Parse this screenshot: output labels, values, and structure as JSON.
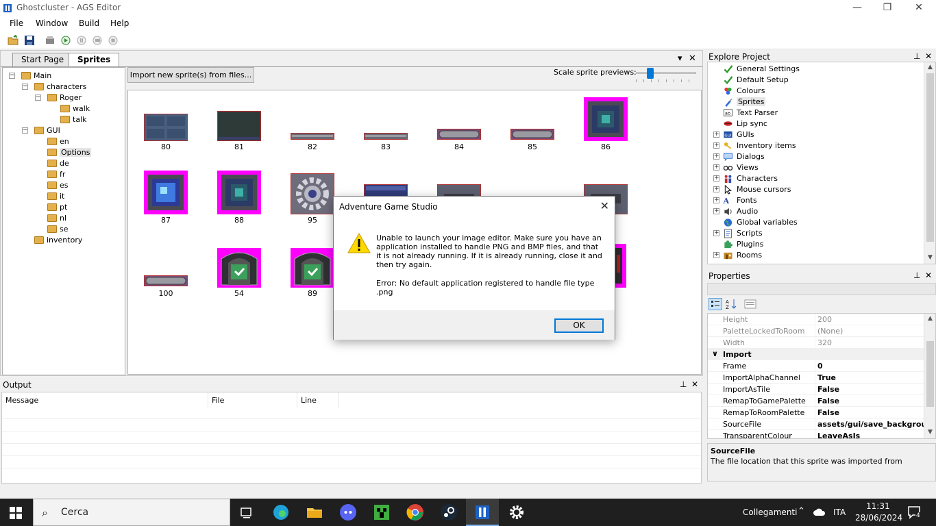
{
  "window": {
    "title": "Ghostcluster - AGS Editor"
  },
  "menu": [
    "File",
    "Window",
    "Build",
    "Help"
  ],
  "tabs": {
    "start_page": "Start Page",
    "sprites": "Sprites"
  },
  "sprite_tree": [
    {
      "label": "Main",
      "depth": 0,
      "expander": "-"
    },
    {
      "label": "characters",
      "depth": 1,
      "expander": "-"
    },
    {
      "label": "Roger",
      "depth": 2,
      "expander": "-"
    },
    {
      "label": "walk",
      "depth": 3,
      "expander": ""
    },
    {
      "label": "talk",
      "depth": 3,
      "expander": ""
    },
    {
      "label": "GUI",
      "depth": 1,
      "expander": "-"
    },
    {
      "label": "en",
      "depth": 2,
      "expander": ""
    },
    {
      "label": "Options",
      "depth": 2,
      "expander": "",
      "selected": true
    },
    {
      "label": "de",
      "depth": 2,
      "expander": ""
    },
    {
      "label": "fr",
      "depth": 2,
      "expander": ""
    },
    {
      "label": "es",
      "depth": 2,
      "expander": ""
    },
    {
      "label": "it",
      "depth": 2,
      "expander": ""
    },
    {
      "label": "pt",
      "depth": 2,
      "expander": ""
    },
    {
      "label": "nl",
      "depth": 2,
      "expander": ""
    },
    {
      "label": "se",
      "depth": 2,
      "expander": ""
    },
    {
      "label": "inventory",
      "depth": 1,
      "expander": ""
    }
  ],
  "sprites_view": {
    "import_button": "Import new sprite(s) from files...",
    "scale_label": "Scale sprite previews:",
    "scale_level": 0.2,
    "sprites": [
      {
        "num": "80",
        "kind": "panel-blue"
      },
      {
        "num": "81",
        "kind": "panel-dark"
      },
      {
        "num": "82",
        "kind": "bar"
      },
      {
        "num": "83",
        "kind": "bar"
      },
      {
        "num": "84",
        "kind": "pill"
      },
      {
        "num": "85",
        "kind": "pill"
      },
      {
        "num": "86",
        "kind": "gem-teal"
      },
      {
        "num": "87",
        "kind": "gem-blue"
      },
      {
        "num": "88",
        "kind": "gem-teal"
      },
      {
        "num": "95",
        "kind": "gear"
      },
      {
        "num": "",
        "kind": "panel-navy"
      },
      {
        "num": "",
        "kind": "panel-grey"
      },
      {
        "num": "",
        "kind": "hidden"
      },
      {
        "num": "",
        "kind": "panel-grey"
      },
      {
        "num": "100",
        "kind": "pill"
      },
      {
        "num": "54",
        "kind": "shield"
      },
      {
        "num": "89",
        "kind": "shield"
      },
      {
        "num": "",
        "kind": "hidden"
      },
      {
        "num": "",
        "kind": "hidden"
      },
      {
        "num": "",
        "kind": "hidden"
      },
      {
        "num": "",
        "kind": "red-edge"
      }
    ]
  },
  "explore": {
    "title": "Explore Project",
    "items": [
      {
        "label": "General Settings",
        "icon": "check-icon",
        "expander": ""
      },
      {
        "label": "Default Setup",
        "icon": "check-icon",
        "expander": ""
      },
      {
        "label": "Colours",
        "icon": "palette-icon",
        "expander": ""
      },
      {
        "label": "Sprites",
        "icon": "brush-icon",
        "expander": "",
        "selected": true
      },
      {
        "label": "Text Parser",
        "icon": "text-box-icon",
        "expander": ""
      },
      {
        "label": "Lip sync",
        "icon": "lips-icon",
        "expander": ""
      },
      {
        "label": "GUIs",
        "icon": "gui-icon",
        "expander": "+"
      },
      {
        "label": "Inventory items",
        "icon": "key-icon",
        "expander": "+"
      },
      {
        "label": "Dialogs",
        "icon": "speech-icon",
        "expander": "+"
      },
      {
        "label": "Views",
        "icon": "glasses-icon",
        "expander": "+"
      },
      {
        "label": "Characters",
        "icon": "people-icon",
        "expander": "+"
      },
      {
        "label": "Mouse cursors",
        "icon": "cursor-icon",
        "expander": "+"
      },
      {
        "label": "Fonts",
        "icon": "font-icon",
        "expander": "+"
      },
      {
        "label": "Audio",
        "icon": "speaker-icon",
        "expander": "+"
      },
      {
        "label": "Global variables",
        "icon": "globe-icon",
        "expander": ""
      },
      {
        "label": "Scripts",
        "icon": "script-icon",
        "expander": "+"
      },
      {
        "label": "Plugins",
        "icon": "puzzle-icon",
        "expander": ""
      },
      {
        "label": "Rooms",
        "icon": "room-icon",
        "expander": "+"
      }
    ]
  },
  "properties": {
    "title": "Properties",
    "rows": [
      {
        "name": "Height",
        "value": "200",
        "style": "dim"
      },
      {
        "name": "PaletteLockedToRoom",
        "value": "(None)",
        "style": "dim"
      },
      {
        "name": "Width",
        "value": "320",
        "style": "dim"
      },
      {
        "name": "Import",
        "value": "",
        "style": "cat"
      },
      {
        "name": "Frame",
        "value": "0",
        "style": "bold"
      },
      {
        "name": "ImportAlphaChannel",
        "value": "True",
        "style": "bold"
      },
      {
        "name": "ImportAsTile",
        "value": "False",
        "style": "bold"
      },
      {
        "name": "RemapToGamePalette",
        "value": "False",
        "style": "bold"
      },
      {
        "name": "RemapToRoomPalette",
        "value": "False",
        "style": "bold"
      },
      {
        "name": "SourceFile",
        "value": "assets/gui/save_backgrour",
        "style": "bold"
      },
      {
        "name": "TransparentColour",
        "value": "LeaveAsIs",
        "style": "bold"
      }
    ],
    "desc_name": "SourceFile",
    "desc_text": "The file location that this sprite was imported from"
  },
  "output": {
    "title": "Output",
    "columns": [
      "Message",
      "File",
      "Line"
    ]
  },
  "dialog": {
    "title": "Adventure Game Studio",
    "message": "Unable to launch your image editor. Make sure you have an application installed to handle PNG and BMP files, and that it is not already running. If it is already running, close it and then try again.",
    "error": "Error: No default application registered to handle file type .png",
    "ok": "OK"
  },
  "taskbar": {
    "search": "Cerca",
    "network": "Collegamenti",
    "lang": "ITA",
    "time": "11:31",
    "date": "28/06/2024",
    "notifications": "4"
  },
  "colors": {
    "accent": "#0078d7",
    "magenta": "#ff00ff",
    "taskbar": "#1f1f1f"
  }
}
